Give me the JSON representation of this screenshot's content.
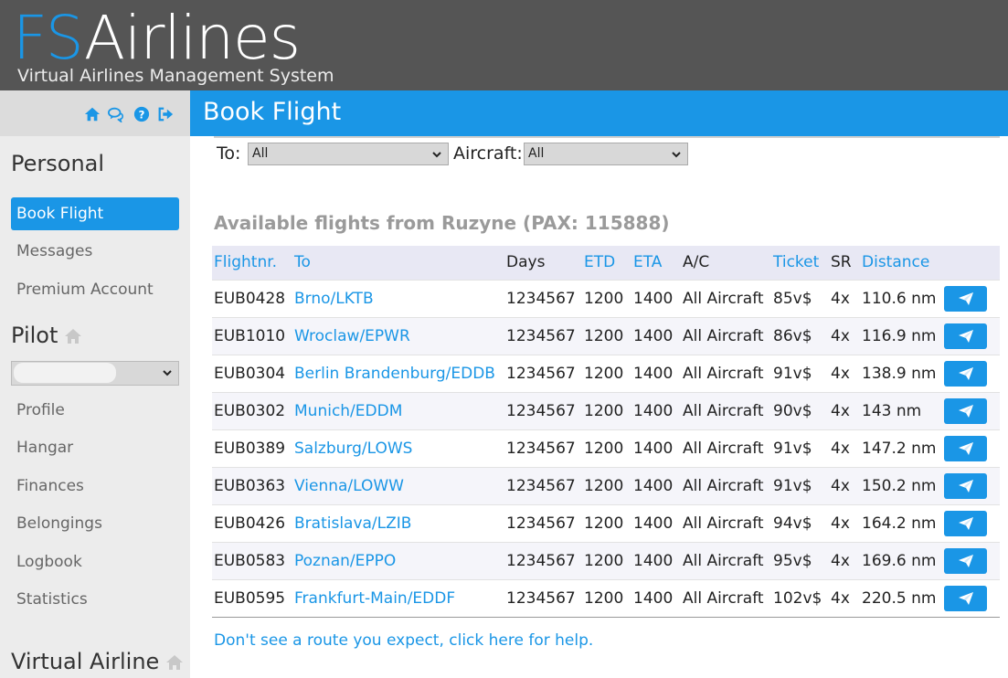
{
  "header": {
    "logo_fs": "FS",
    "logo_airlines": "Airlines",
    "tagline": "Virtual Airlines Management System"
  },
  "colors": {
    "accent": "#1a96e6",
    "header_bg": "#555555",
    "sidebar_bg": "#ececec"
  },
  "sidebar": {
    "icons": [
      "home-icon",
      "chat-icon",
      "help-icon",
      "logout-icon"
    ],
    "personal_heading": "Personal",
    "personal_items": [
      {
        "label": "Book Flight",
        "active": true
      },
      {
        "label": "Messages"
      },
      {
        "label": "Premium Account"
      }
    ],
    "pilot_heading": "Pilot",
    "pilot_items": [
      {
        "label": "Profile"
      },
      {
        "label": "Hangar"
      },
      {
        "label": "Finances"
      },
      {
        "label": "Belongings"
      },
      {
        "label": "Logbook"
      },
      {
        "label": "Statistics"
      }
    ],
    "virtual_airline_heading": "Virtual Airline"
  },
  "page": {
    "title": "Book Flight"
  },
  "filters": {
    "to_label": "To:",
    "to_value": "All",
    "aircraft_label": "Aircraft:",
    "aircraft_value": "All"
  },
  "available_heading": "Available flights from Ruzyne (PAX: 115888)",
  "table": {
    "headers": [
      "Flightnr.",
      "To",
      "Days",
      "ETD",
      "ETA",
      "A/C",
      "Ticket",
      "SR",
      "Distance"
    ],
    "rows": [
      {
        "flight": "EUB0428",
        "to": "Brno/LKTB",
        "days": "1234567",
        "etd": "1200",
        "eta": "1400",
        "ac": "All Aircraft",
        "ticket": "85v$",
        "sr": "4x",
        "distance": "110.6 nm"
      },
      {
        "flight": "EUB1010",
        "to": "Wroclaw/EPWR",
        "days": "1234567",
        "etd": "1200",
        "eta": "1400",
        "ac": "All Aircraft",
        "ticket": "86v$",
        "sr": "4x",
        "distance": "116.9 nm"
      },
      {
        "flight": "EUB0304",
        "to": "Berlin Brandenburg/EDDB",
        "days": "1234567",
        "etd": "1200",
        "eta": "1400",
        "ac": "All Aircraft",
        "ticket": "91v$",
        "sr": "4x",
        "distance": "138.9 nm"
      },
      {
        "flight": "EUB0302",
        "to": "Munich/EDDM",
        "days": "1234567",
        "etd": "1200",
        "eta": "1400",
        "ac": "All Aircraft",
        "ticket": "90v$",
        "sr": "4x",
        "distance": "143 nm"
      },
      {
        "flight": "EUB0389",
        "to": "Salzburg/LOWS",
        "days": "1234567",
        "etd": "1200",
        "eta": "1400",
        "ac": "All Aircraft",
        "ticket": "91v$",
        "sr": "4x",
        "distance": "147.2 nm"
      },
      {
        "flight": "EUB0363",
        "to": "Vienna/LOWW",
        "days": "1234567",
        "etd": "1200",
        "eta": "1400",
        "ac": "All Aircraft",
        "ticket": "91v$",
        "sr": "4x",
        "distance": "150.2 nm"
      },
      {
        "flight": "EUB0426",
        "to": "Bratislava/LZIB",
        "days": "1234567",
        "etd": "1200",
        "eta": "1400",
        "ac": "All Aircraft",
        "ticket": "94v$",
        "sr": "4x",
        "distance": "164.2 nm"
      },
      {
        "flight": "EUB0583",
        "to": "Poznan/EPPO",
        "days": "1234567",
        "etd": "1200",
        "eta": "1400",
        "ac": "All Aircraft",
        "ticket": "95v$",
        "sr": "4x",
        "distance": "169.6 nm"
      },
      {
        "flight": "EUB0595",
        "to": "Frankfurt-Main/EDDF",
        "days": "1234567",
        "etd": "1200",
        "eta": "1400",
        "ac": "All Aircraft",
        "ticket": "102v$",
        "sr": "4x",
        "distance": "220.5 nm"
      }
    ]
  },
  "help_link": "Don't see a route you expect, click here for help."
}
